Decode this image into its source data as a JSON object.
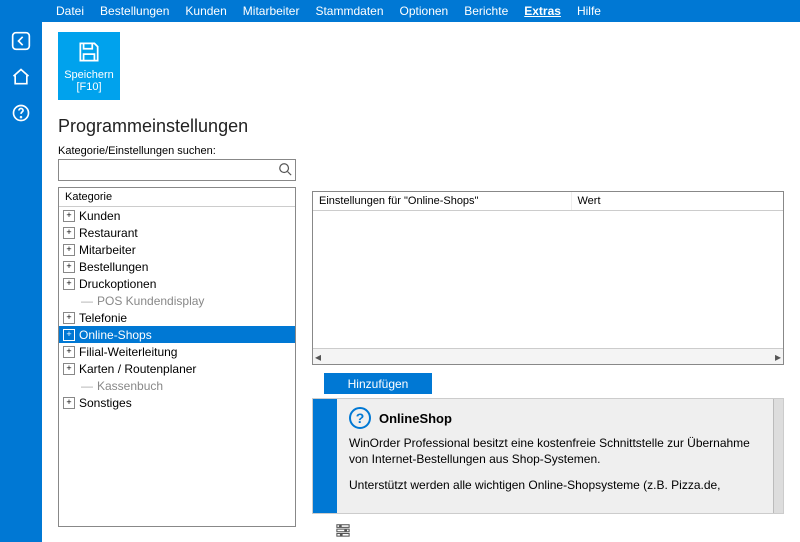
{
  "menubar": [
    "Datei",
    "Bestellungen",
    "Kunden",
    "Mitarbeiter",
    "Stammdaten",
    "Optionen",
    "Berichte",
    "Extras",
    "Hilfe"
  ],
  "menubar_active": "Extras",
  "save_button": {
    "label": "Speichern",
    "shortcut": "[F10]"
  },
  "page_title": "Programmeinstellungen",
  "search": {
    "label": "Kategorie/Einstellungen suchen:",
    "value": ""
  },
  "tree": {
    "header": "Kategorie",
    "items": [
      {
        "label": "Kunden",
        "expandable": true
      },
      {
        "label": "Restaurant",
        "expandable": true
      },
      {
        "label": "Mitarbeiter",
        "expandable": true
      },
      {
        "label": "Bestellungen",
        "expandable": true
      },
      {
        "label": "Druckoptionen",
        "expandable": true
      },
      {
        "label": "POS Kundendisplay",
        "expandable": false,
        "child": true,
        "faded": true
      },
      {
        "label": "Telefonie",
        "expandable": true
      },
      {
        "label": "Online-Shops",
        "expandable": true,
        "selected": true
      },
      {
        "label": "Filial-Weiterleitung",
        "expandable": true
      },
      {
        "label": "Karten / Routenplaner",
        "expandable": true
      },
      {
        "label": "Kassenbuch",
        "expandable": false,
        "child": true,
        "faded": true
      },
      {
        "label": "Sonstiges",
        "expandable": true
      }
    ]
  },
  "grid": {
    "col1": "Einstellungen für \"Online-Shops\"",
    "col2": "Wert"
  },
  "add_button": "Hinzufügen",
  "info": {
    "title": "OnlineShop",
    "p1": "WinOrder Professional besitzt eine kostenfreie Schnittstelle zur Übernahme von Internet-Bestellungen aus Shop-Systemen.",
    "p2": "Unterstützt werden alle wichtigen Online-Shopsysteme (z.B. Pizza.de,"
  }
}
